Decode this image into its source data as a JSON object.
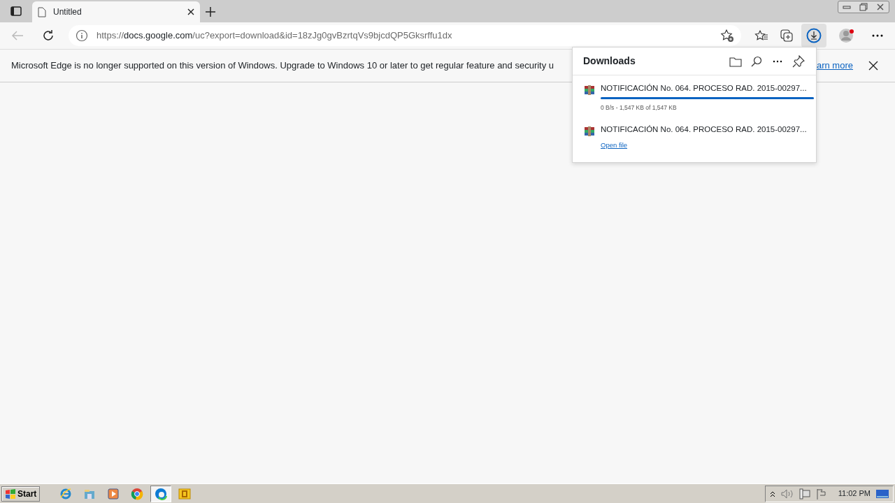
{
  "tabs": [
    {
      "title": "Untitled",
      "selected": true
    }
  ],
  "address": {
    "scheme": "https://",
    "host": "docs.google.com",
    "path": "/uc?export=download&id=18zJg0gvBzrtqVs9bjcdQP5Gksrffu1dx"
  },
  "banner": {
    "message": "Microsoft Edge is no longer supported on this version of Windows. Upgrade to Windows 10 or later to get regular feature and security u",
    "link": "arn more"
  },
  "downloads_panel": {
    "title": "Downloads",
    "items": [
      {
        "kind": "progress",
        "name": "NOTIFICACIÓN No. 064. PROCESO RAD. 2015-00297...",
        "level": 1,
        "status": "0 B/s - 1,547 KB of 1,547 KB"
      },
      {
        "kind": "done",
        "name": "NOTIFICACIÓN No. 064. PROCESO RAD. 2015-00297...",
        "action": "Open file"
      }
    ]
  },
  "taskbar": {
    "start": "Start",
    "apps": [
      {
        "kind": "ie",
        "selected": false
      },
      {
        "kind": "folder",
        "selected": false
      },
      {
        "kind": "media",
        "selected": false
      },
      {
        "kind": "chrome",
        "selected": false
      },
      {
        "kind": "edge",
        "selected": true
      },
      {
        "kind": "office",
        "selected": false
      }
    ],
    "clock": "11:02 PM"
  }
}
